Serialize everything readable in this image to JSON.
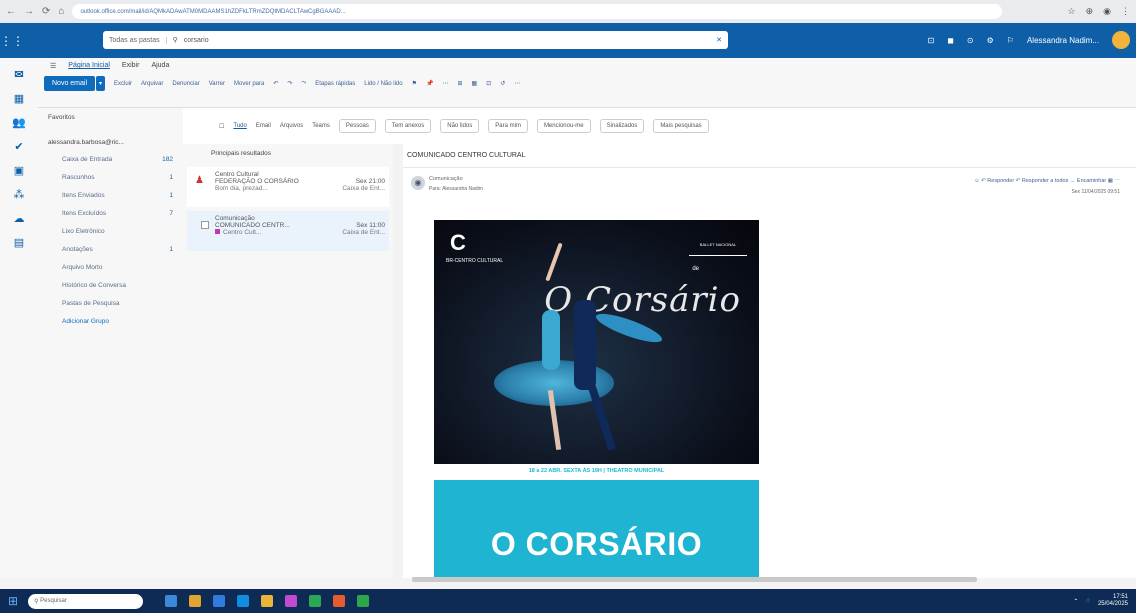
{
  "browser": {
    "url": "outlook.office.com/mail/id/AQMkADAwATM0MDAAMS1hZDFkLTRmZDQtMDACLTAwCgBGAAAD...",
    "nav": [
      "←",
      "→",
      "⟳",
      "⌂"
    ],
    "right_icons": [
      "☆",
      "⊕",
      "⋮"
    ]
  },
  "outlook": {
    "search_scope": "Todas as pastas",
    "search_query": "corsario",
    "user_name": "Alessandra Nadim...",
    "header_icons": [
      "⊡",
      "◼",
      "⊙",
      "⚙",
      "⚐"
    ]
  },
  "rail": [
    "✉",
    "▦",
    "👥",
    "✔",
    "▣",
    "⁂",
    "☁",
    "▤"
  ],
  "ribbon": {
    "tabs": [
      "☰",
      "Página Inicial",
      "Exibir",
      "Ajuda"
    ],
    "new_mail": "Novo email",
    "commands": [
      "Excluir",
      "Arquivar",
      "Denunciar",
      "Varrer",
      "Mover para",
      "↶",
      "↷",
      "⤳",
      "Etapas rápidas",
      "Lido / Não lido",
      "⚑",
      "📌",
      "⋯",
      "⊞",
      "▦",
      "⊡",
      "↺",
      "⋯"
    ]
  },
  "folders": {
    "favorites": "Favoritos",
    "account": "alessandra.barbosa@ric...",
    "items": [
      {
        "label": "Caixa de Entrada",
        "count": "182"
      },
      {
        "label": "Rascunhos",
        "count": "1"
      },
      {
        "label": "Itens Enviados",
        "count": "1"
      },
      {
        "label": "Itens Excluídos",
        "count": "7"
      },
      {
        "label": "Lixo Eletrônico",
        "count": ""
      },
      {
        "label": "Anotações",
        "count": "1"
      },
      {
        "label": "Arquivo Morto",
        "count": ""
      },
      {
        "label": "Histórico de Conversa",
        "count": ""
      },
      {
        "label": "Pastas de Pesquisa",
        "count": ""
      }
    ],
    "group": "Adicionar Grupo"
  },
  "filters": {
    "items": [
      "Tudo",
      "Email",
      "Arquivos",
      "Teams",
      "Pessoas"
    ],
    "chips": [
      "Tem anexos",
      "Não lidos",
      "Para mim",
      "Mencionou-me",
      "Sinalizados",
      "Mais pesquisas"
    ]
  },
  "list": {
    "header": "Principais resultados",
    "messages": [
      {
        "from": "Centro Cultural",
        "subject": "FEDERAÇÃO O CORSÁRIO",
        "time": "Sex 21:00",
        "preview": "Bom dia, prezad...",
        "folder": "Caixa de Ent..."
      },
      {
        "from": "Comunicação",
        "subject": "COMUNICADO CENTR...",
        "time": "Sex 11:00",
        "preview": "Centro Cult...",
        "folder": "Caixa de Ent..."
      }
    ]
  },
  "reading": {
    "title": "COMUNICADO CENTRO CULTURAL",
    "sender": "Comunicação",
    "to": "Para: Alessandra Nadim",
    "actions": "☺  ↶ Responder  ↶ Responder a todos  → Encaminhar  ▦  ⋯",
    "date": "Sex 11/04/2025 09:51",
    "poster_logo": "C",
    "poster_logo_sub": "BR-CENTRO CULTURAL",
    "poster_brand": "BALLET NACIONAL",
    "poster_de": "de",
    "poster_script": "O Corsário",
    "band": "18 a 22 ABR. SEXTA ÀS 19H | THEATRO MUNICIPAL",
    "big_title": "O CORSÁRIO"
  },
  "taskbar": {
    "search": "Pesquisar",
    "apps_colors": [
      "#3b89d8",
      "#e2a430",
      "#2f7bde",
      "#0f8ee0",
      "#e8b43a",
      "#c04ad0",
      "#2aa857",
      "#e65c2e",
      "#2ca84a"
    ],
    "time": "17:51",
    "date": "25/04/2025"
  }
}
